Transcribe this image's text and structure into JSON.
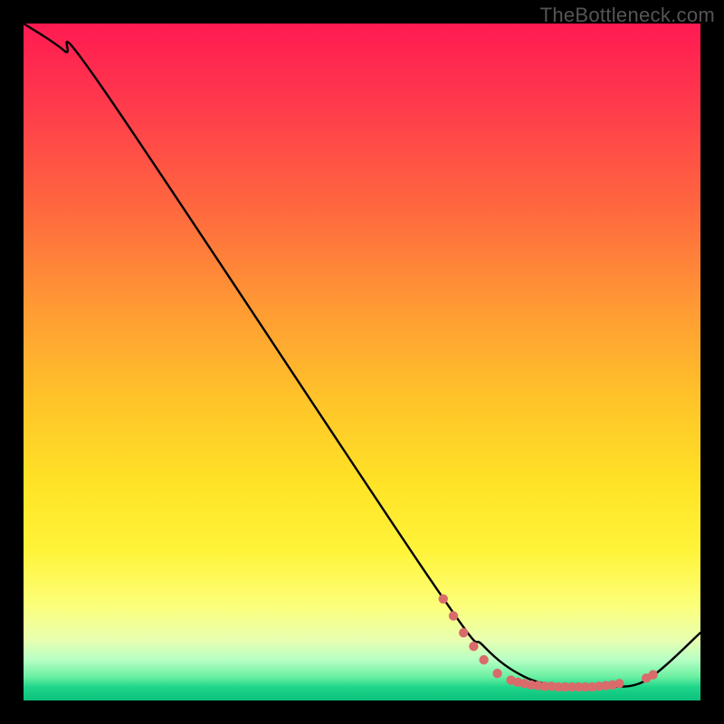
{
  "watermark": "TheBottleneck.com",
  "chart_data": {
    "type": "line",
    "title": "",
    "xlabel": "",
    "ylabel": "",
    "xlim": [
      0,
      100
    ],
    "ylim": [
      0,
      100
    ],
    "series": [
      {
        "name": "curve",
        "x": [
          0,
          6,
          12,
          60,
          68,
          74,
          80,
          86,
          92,
          100
        ],
        "y": [
          100,
          96,
          90,
          18,
          8,
          3.5,
          2,
          2,
          3,
          10
        ]
      }
    ],
    "markers": {
      "name": "dots",
      "color": "#d96b6b",
      "points": [
        {
          "x": 62,
          "y": 15
        },
        {
          "x": 63.5,
          "y": 12.5
        },
        {
          "x": 65,
          "y": 10
        },
        {
          "x": 66.5,
          "y": 8
        },
        {
          "x": 68,
          "y": 6
        },
        {
          "x": 70,
          "y": 4
        },
        {
          "x": 72,
          "y": 3
        },
        {
          "x": 73,
          "y": 2.7
        },
        {
          "x": 74,
          "y": 2.5
        },
        {
          "x": 75,
          "y": 2.3
        },
        {
          "x": 76,
          "y": 2.2
        },
        {
          "x": 77,
          "y": 2.1
        },
        {
          "x": 78,
          "y": 2.1
        },
        {
          "x": 79,
          "y": 2.0
        },
        {
          "x": 80,
          "y": 2.0
        },
        {
          "x": 81,
          "y": 2.0
        },
        {
          "x": 82,
          "y": 2.0
        },
        {
          "x": 83,
          "y": 2.0
        },
        {
          "x": 84,
          "y": 2.0
        },
        {
          "x": 85,
          "y": 2.1
        },
        {
          "x": 86,
          "y": 2.2
        },
        {
          "x": 87,
          "y": 2.3
        },
        {
          "x": 88,
          "y": 2.5
        },
        {
          "x": 92,
          "y": 3.3
        },
        {
          "x": 93,
          "y": 3.8
        }
      ]
    },
    "gradient_stops": [
      {
        "pos": 0.0,
        "color": "#ff1a52"
      },
      {
        "pos": 0.5,
        "color": "#ffc529"
      },
      {
        "pos": 0.8,
        "color": "#fff43a"
      },
      {
        "pos": 0.96,
        "color": "#6af0a2"
      },
      {
        "pos": 1.0,
        "color": "#0bc07c"
      }
    ]
  }
}
